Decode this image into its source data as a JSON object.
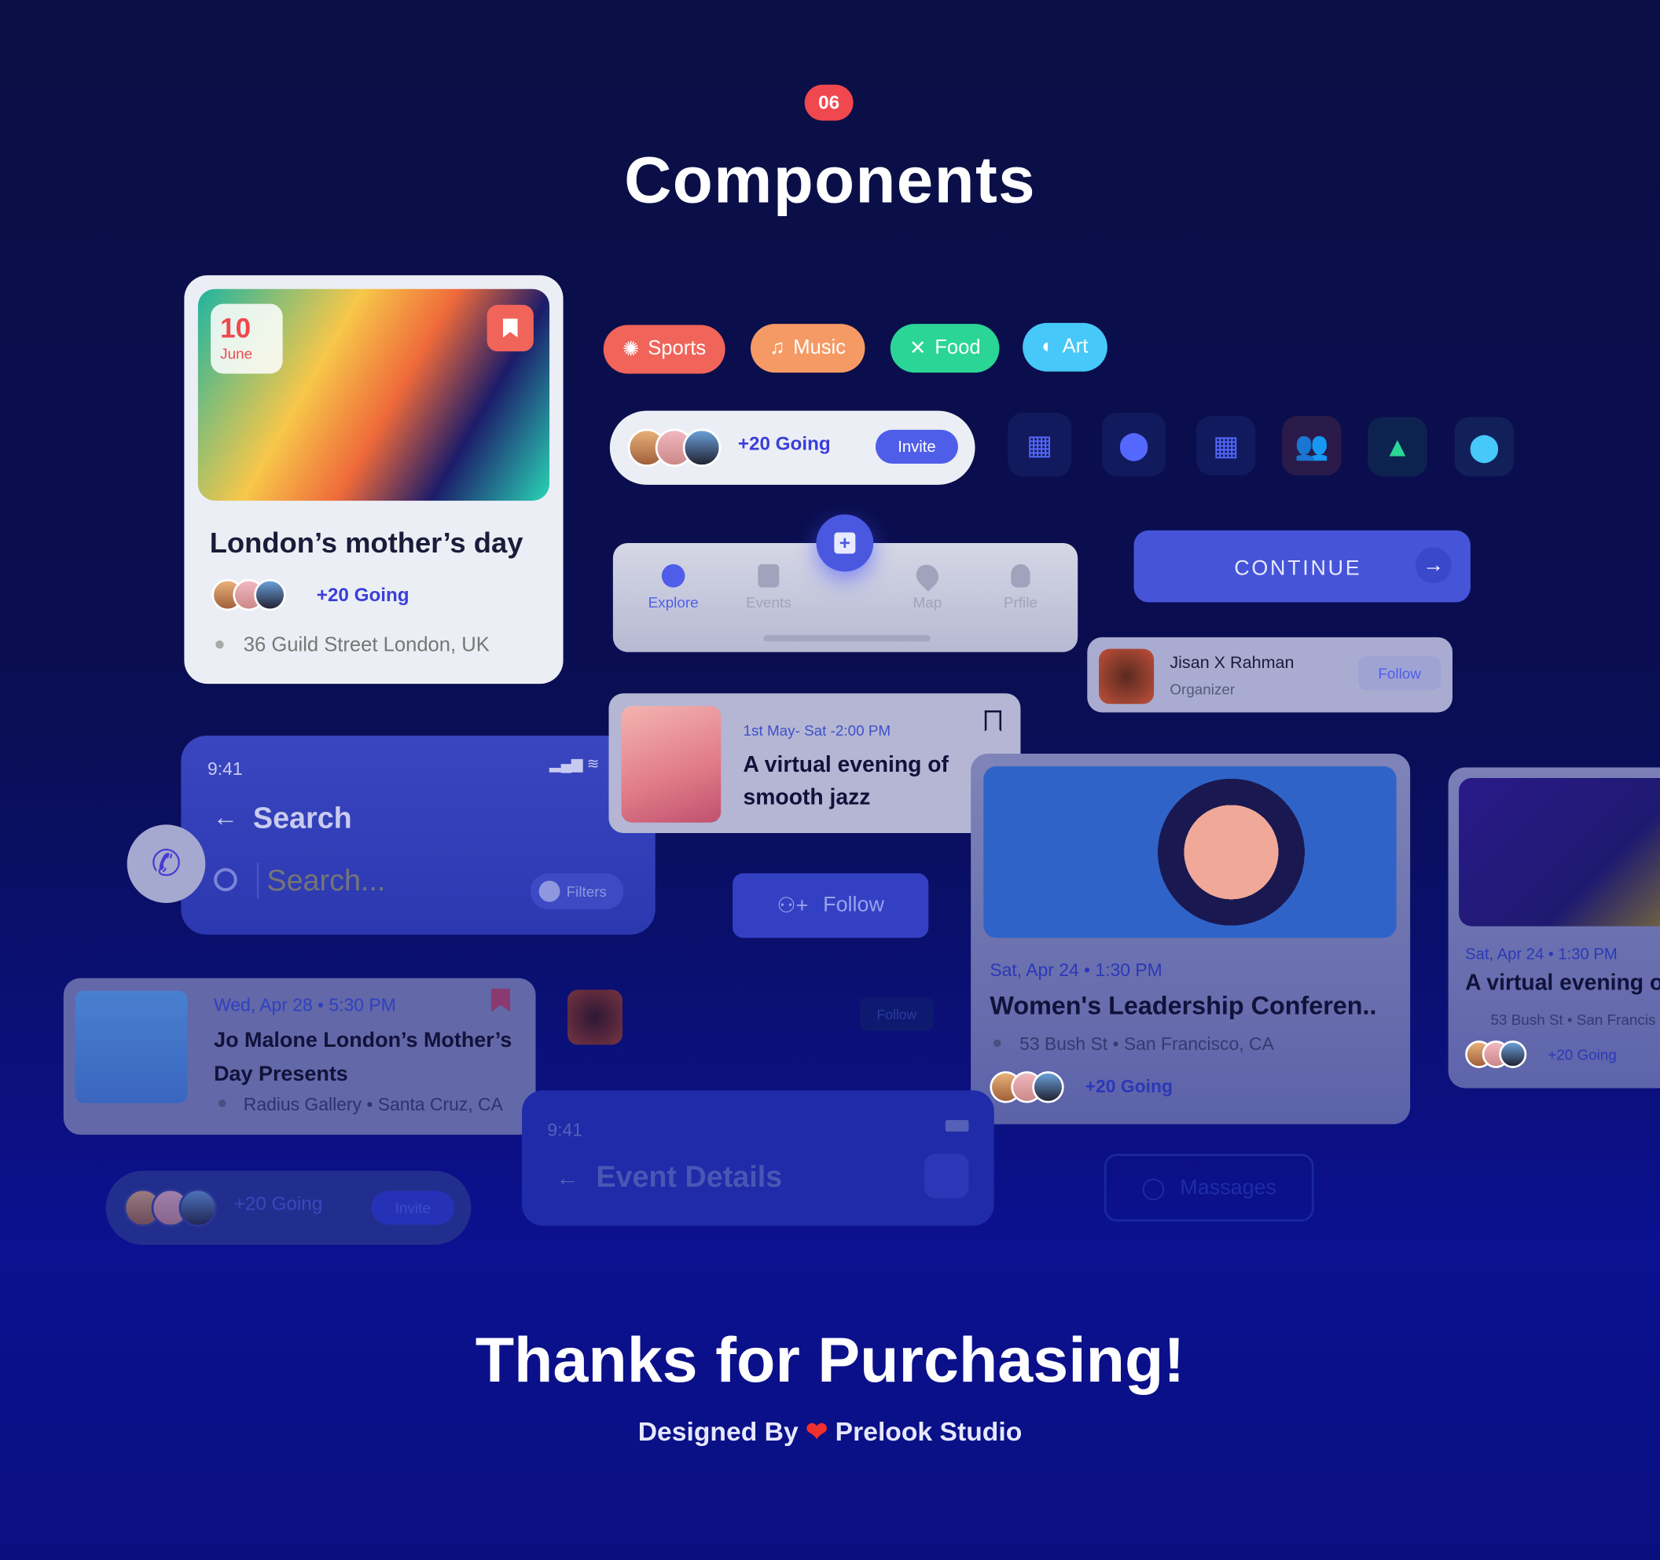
{
  "header": {
    "badge": "06",
    "title": "Components"
  },
  "event_card": {
    "day": "10",
    "month": "June",
    "title": "London’s mother’s day",
    "going": "+20 Going",
    "address": "36 Guild Street London, UK"
  },
  "chips": [
    {
      "label": "Sports",
      "color": "#f0645a",
      "icon": "basketball-icon"
    },
    {
      "label": "Music",
      "color": "#f59a64",
      "icon": "music-note-icon"
    },
    {
      "label": "Food",
      "color": "#2ad596",
      "icon": "fork-knife-icon"
    },
    {
      "label": "Art",
      "color": "#46c8f8",
      "icon": "palette-icon"
    }
  ],
  "going_pill": {
    "going": "+20 Going",
    "invite": "Invite"
  },
  "icons": [
    {
      "icon": "calendar-icon",
      "color": "#5468ff"
    },
    {
      "icon": "location-pin-icon",
      "color": "#5468ff"
    },
    {
      "icon": "calendar-icon",
      "color": "#5468ff"
    },
    {
      "icon": "users-icon",
      "color": "#f0645a"
    },
    {
      "icon": "image-icon",
      "color": "#2ad596"
    },
    {
      "icon": "location-pin-icon",
      "color": "#46c8f8"
    }
  ],
  "tabbar": {
    "items": [
      "Explore",
      "Events",
      "Map",
      "Prfile"
    ],
    "active": "Explore"
  },
  "continue_button": "CONTINUE",
  "organizer": {
    "name": "Jisan X Rahman",
    "role": "Organizer",
    "follow": "Follow"
  },
  "jazz_card": {
    "date": "1st  May- Sat -2:00 PM",
    "title": "A virtual evening of smooth jazz"
  },
  "search_screen": {
    "time": "9:41",
    "title": "Search",
    "placeholder": "Search...",
    "filters": "Filters"
  },
  "follow_button": "Follow",
  "conference_card": {
    "date": "Sat, Apr 24 • 1:30 PM",
    "title": "Women's Leadership Conferen..",
    "address": "53 Bush St • San Francisco, CA",
    "going": "+20 Going"
  },
  "side_card": {
    "date": "Sat, Apr 24 • 1:30 PM",
    "title": "A virtual evening o",
    "address": "53 Bush St • San Francis",
    "going": "+20 Going"
  },
  "jo_card": {
    "date": "Wed, Apr 28 • 5:30 PM",
    "title": "Jo Malone London’s Mother’s Day Presents",
    "address": "Radius Gallery • Santa Cruz, CA"
  },
  "faded_follow": "Follow",
  "going_pill2": {
    "going": "+20 Going",
    "invite": "Invite"
  },
  "event_details": {
    "time": "9:41",
    "title": "Event Details"
  },
  "messages_button": "Massages",
  "footer": {
    "thanks": "Thanks for Purchasing!",
    "designed_by": "Designed By",
    "studio": "Prelook Studio"
  }
}
